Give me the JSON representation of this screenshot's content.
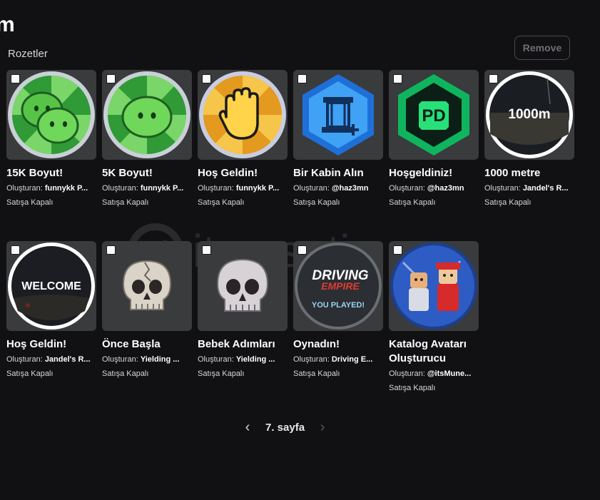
{
  "header": {
    "title": "m",
    "section": "Rozetler",
    "remove_label": "Remove"
  },
  "watermark": "itemsatis",
  "badges": [
    {
      "name": "15K Boyut!",
      "creator_prefix": "Oluşturan:",
      "creator": "funnykk P...",
      "status": "Satışa Kapalı",
      "icon": "slime-double-icon"
    },
    {
      "name": "5K Boyut!",
      "creator_prefix": "Oluşturan:",
      "creator": "funnykk P...",
      "status": "Satışa Kapalı",
      "icon": "slime-single-icon"
    },
    {
      "name": "Hoş Geldin!",
      "creator_prefix": "Oluşturan:",
      "creator": "funnykk P...",
      "status": "Satışa Kapalı",
      "icon": "wave-hand-icon"
    },
    {
      "name": "Bir Kabin Alın",
      "creator_prefix": "Oluşturan:",
      "creator": "@haz3mn",
      "status": "Satışa Kapalı",
      "icon": "cabin-icon"
    },
    {
      "name": "Hoşgeldiniz!",
      "creator_prefix": "Oluşturan:",
      "creator": "@haz3mn",
      "status": "Satışa Kapalı",
      "icon": "pd-icon",
      "icon_text": "PD"
    },
    {
      "name": "1000 metre",
      "creator_prefix": "Oluşturan:",
      "creator": "Jandel's R...",
      "status": "Satışa Kapalı",
      "icon": "distance-icon",
      "icon_text": "1000m"
    },
    {
      "name": "Hoş Geldin!",
      "creator_prefix": "Oluşturan:",
      "creator": "Jandel's R...",
      "status": "Satışa Kapalı",
      "icon": "welcome-icon",
      "icon_text": "WELCOME"
    },
    {
      "name": "Önce Başla",
      "creator_prefix": "Oluşturan:",
      "creator": "Yielding ...",
      "status": "Satışa Kapalı",
      "icon": "cracked-skull-icon"
    },
    {
      "name": "Bebek Adımları",
      "creator_prefix": "Oluşturan:",
      "creator": "Yielding ...",
      "status": "Satışa Kapalı",
      "icon": "skull-icon"
    },
    {
      "name": "Oynadın!",
      "creator_prefix": "Oluşturan:",
      "creator": "Driving E...",
      "status": "Satışa Kapalı",
      "icon": "driving-empire-icon",
      "icon_text_1": "DRIVING",
      "icon_text_2": "EMPIRE",
      "icon_text_3": "YOU PLAYED!"
    },
    {
      "name": "Katalog Avatarı Oluşturucu",
      "creator_prefix": "Oluşturan:",
      "creator": "@itsMune...",
      "status": "Satışa Kapalı",
      "icon": "avatar-group-icon"
    }
  ],
  "pagination": {
    "prev_icon": "chevron-left-icon",
    "page_label": "7. sayfa",
    "next_icon": "chevron-right-icon"
  }
}
